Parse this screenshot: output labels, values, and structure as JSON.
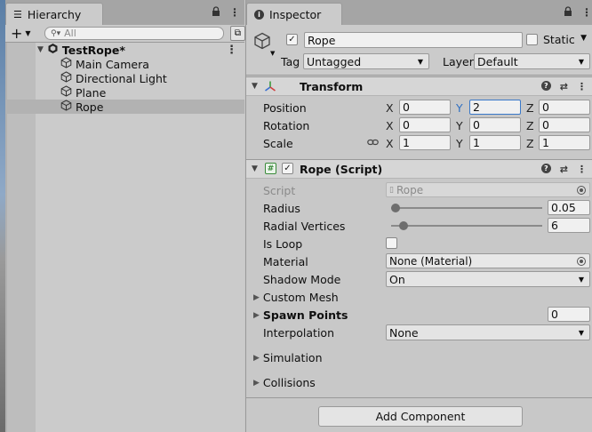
{
  "hierarchy": {
    "tab_label": "Hierarchy",
    "search_placeholder": "All",
    "scene": {
      "name": "TestRope*"
    },
    "items": [
      {
        "label": "Main Camera"
      },
      {
        "label": "Directional Light"
      },
      {
        "label": "Plane"
      },
      {
        "label": "Rope",
        "selected": true
      }
    ]
  },
  "inspector": {
    "tab_label": "Inspector",
    "object": {
      "name": "Rope",
      "active": true,
      "static_label": "Static",
      "tag_label": "Tag",
      "tag_value": "Untagged",
      "layer_label": "Layer",
      "layer_value": "Default"
    },
    "transform": {
      "title": "Transform",
      "position_label": "Position",
      "rotation_label": "Rotation",
      "scale_label": "Scale",
      "axis_x": "X",
      "axis_y": "Y",
      "axis_z": "Z",
      "position": {
        "x": "0",
        "y": "2",
        "z": "0"
      },
      "rotation": {
        "x": "0",
        "y": "0",
        "z": "0"
      },
      "scale": {
        "x": "1",
        "y": "1",
        "z": "1"
      }
    },
    "rope_script": {
      "title": "Rope (Script)",
      "enabled": true,
      "script_label": "Script",
      "script_value": "Rope",
      "radius_label": "Radius",
      "radius_value": "0.05",
      "radius_fraction": 0.02,
      "radial_vertices_label": "Radial Vertices",
      "radial_vertices_value": "6",
      "radial_vertices_fraction": 0.07,
      "is_loop_label": "Is Loop",
      "is_loop": false,
      "material_label": "Material",
      "material_value": "None (Material)",
      "shadow_mode_label": "Shadow Mode",
      "shadow_mode_value": "On",
      "custom_mesh_label": "Custom Mesh",
      "spawn_points_label": "Spawn Points",
      "spawn_points_value": "0",
      "interpolation_label": "Interpolation",
      "interpolation_value": "None",
      "simulation_label": "Simulation",
      "collisions_label": "Collisions"
    },
    "add_component_label": "Add Component"
  },
  "colors": {
    "accent_focus": "#3a79c9",
    "active_axis": "#2f6fc2",
    "panel_bg": "#c8c8c8",
    "selection_bg": "#b2b2b2"
  }
}
